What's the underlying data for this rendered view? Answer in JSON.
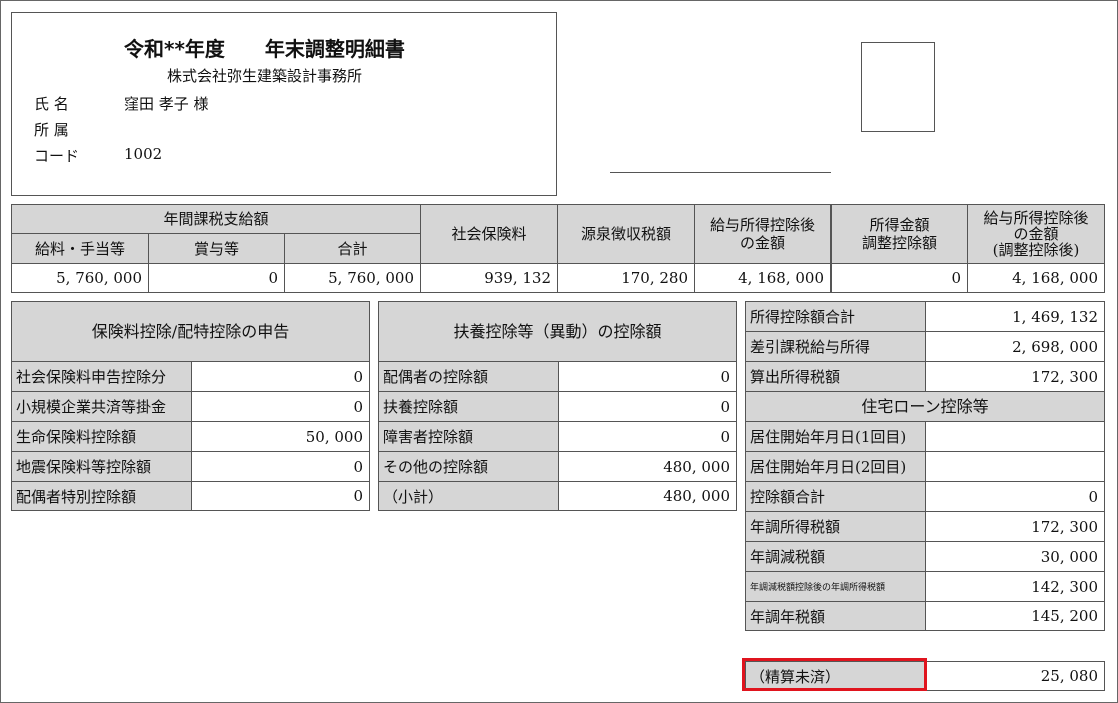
{
  "header": {
    "title": "令和**年度　　年末調整明細書",
    "company": "株式会社弥生建築設計事務所",
    "name_label": "氏 名",
    "name_value": "窪田 孝子 様",
    "affiliation_label": "所 属",
    "affiliation_value": "",
    "code_label": "コード",
    "code_value": "1002"
  },
  "summary": {
    "group_header": "年間課税支給額",
    "col_salary": "給料・手当等",
    "col_bonus": "賞与等",
    "col_total": "合計",
    "col_social": "社会保険料",
    "col_withholding": "源泉徴収税額",
    "col_after_ded_l1": "給与所得控除後",
    "col_after_ded_l2": "の金額",
    "col_adjust_l1": "所得金額",
    "col_adjust_l2": "調整控除額",
    "col_after_adj_l1": "給与所得控除後",
    "col_after_adj_l2": "の金額",
    "col_after_adj_l3": "(調整控除後)",
    "salary": "5, 760, 000",
    "bonus": "0",
    "total": "5, 760, 000",
    "social": "939, 132",
    "withholding": "170, 280",
    "after_ded": "4, 168, 000",
    "adjust": "0",
    "after_adj": "4, 168, 000"
  },
  "insurance": {
    "header": "保険料控除/配特控除の申告",
    "rows": [
      {
        "label": "社会保険料申告控除分",
        "value": "0"
      },
      {
        "label": "小規模企業共済等掛金",
        "value": "0"
      },
      {
        "label": "生命保険料控除額",
        "value": "50, 000"
      },
      {
        "label": "地震保険料等控除額",
        "value": "0"
      },
      {
        "label": "配偶者特別控除額",
        "value": "0"
      }
    ]
  },
  "dependents": {
    "header": "扶養控除等（異動）の控除額",
    "rows": [
      {
        "label": "配偶者の控除額",
        "value": "0"
      },
      {
        "label": "扶養控除額",
        "value": "0"
      },
      {
        "label": "障害者控除額",
        "value": "0"
      },
      {
        "label": "その他の控除額",
        "value": "480, 000"
      },
      {
        "label": "（小計）",
        "value": "480, 000"
      }
    ]
  },
  "right": {
    "rows_top": [
      {
        "label": "所得控除額合計",
        "value": "1, 469, 132"
      },
      {
        "label": "差引課税給与所得",
        "value": "2, 698, 000"
      },
      {
        "label": "算出所得税額",
        "value": "172, 300"
      }
    ],
    "loan_header": "住宅ローン控除等",
    "rows_bottom": [
      {
        "label": "居住開始年月日(1回目)",
        "value": ""
      },
      {
        "label": "居住開始年月日(2回目)",
        "value": ""
      },
      {
        "label": "控除額合計",
        "value": "0"
      },
      {
        "label": "年調所得税額",
        "value": "172, 300"
      },
      {
        "label": "年調減税額",
        "value": "30, 000"
      },
      {
        "label": "年調減税額控除後の年調所得税額",
        "value": "142, 300"
      },
      {
        "label": "年調年税額",
        "value": "145, 200"
      }
    ],
    "settle_label": "（精算未済）",
    "settle_value": "25, 080"
  },
  "colors": {
    "highlight": "#e0141e",
    "label_bg": "#d6d6d6"
  }
}
